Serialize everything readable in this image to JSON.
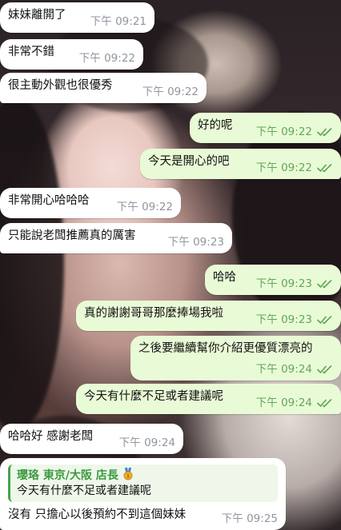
{
  "colors": {
    "incoming_bubble": "#ffffff",
    "outgoing_bubble": "#e9fbd6",
    "outgoing_meta": "#60a75a",
    "incoming_meta": "#8f969e",
    "reply_accent": "#45a34a"
  },
  "messages": [
    {
      "dir": "in",
      "text": "妹妹離開了",
      "time": "下午 09:21"
    },
    {
      "dir": "in",
      "text": "非常不錯",
      "time": "下午 09:22"
    },
    {
      "dir": "in",
      "text": "很主動外觀也很優秀",
      "time": "下午 09:22"
    },
    {
      "dir": "out",
      "text": "好的呢",
      "time": "下午 09:22",
      "status_icon": "double-check-icon"
    },
    {
      "dir": "out",
      "text": "今天是開心的吧",
      "time": "下午 09:22",
      "status_icon": "double-check-icon"
    },
    {
      "dir": "in",
      "text": "非常開心哈哈哈",
      "time": "下午 09:22"
    },
    {
      "dir": "in",
      "text": "只能說老闆推薦真的厲害",
      "time": "下午 09:23"
    },
    {
      "dir": "out",
      "text": "哈哈",
      "time": "下午 09:23",
      "status_icon": "double-check-icon"
    },
    {
      "dir": "out",
      "text": "真的謝謝哥哥那麼捧場我啦",
      "time": "下午 09:23",
      "status_icon": "double-check-icon"
    },
    {
      "dir": "out",
      "text": "之後要繼續幫你介紹更優質漂亮的",
      "time": "下午 09:24",
      "status_icon": "double-check-icon"
    },
    {
      "dir": "out",
      "text": "今天有什麼不足或者建議呢",
      "time": "下午 09:24",
      "status_icon": "double-check-icon"
    },
    {
      "dir": "in",
      "text": "哈哈好 感謝老闆",
      "time": "下午 09:24"
    },
    {
      "dir": "in",
      "reply_to": {
        "name": "瓔珞 東京/大阪 店長",
        "badge_icon": "medal-icon",
        "text": "今天有什麼不足或者建議呢"
      },
      "text": "沒有 只擔心以後預約不到這個妹妹",
      "time": "下午 09:25"
    }
  ]
}
